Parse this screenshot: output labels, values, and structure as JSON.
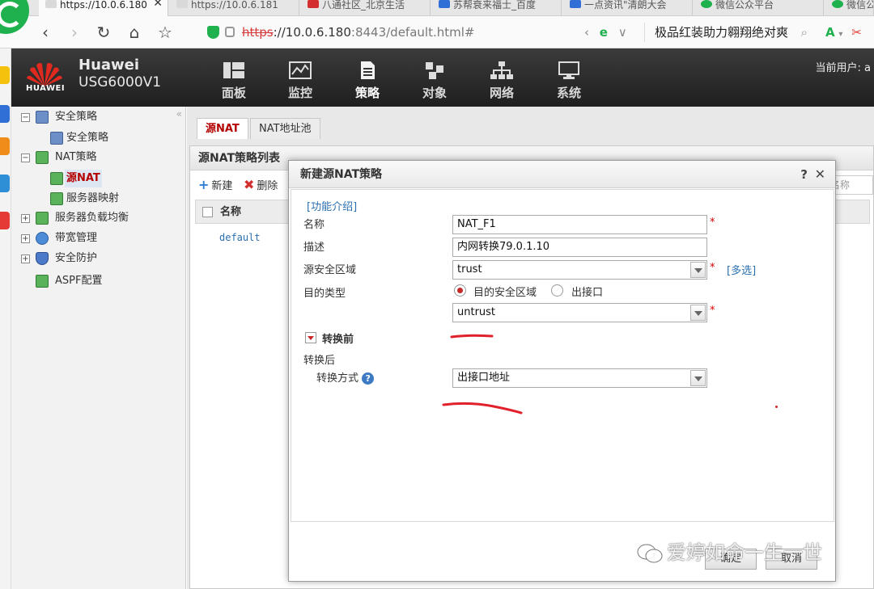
{
  "browser": {
    "tabs": [
      {
        "label": "https://10.0.6.180",
        "active": true
      },
      {
        "label": "https://10.0.6.181"
      },
      {
        "label": "八通社区_北京生活"
      },
      {
        "label": "苏帮衰来福士_百度"
      },
      {
        "label": "一点资讯\"清朗大会"
      },
      {
        "label": "微信公众平台"
      },
      {
        "label": "微信公"
      }
    ],
    "tab_close": "✕",
    "url_scheme": "https",
    "url_host": "://10.0.6.180",
    "url_rest": ":8443/default.html#",
    "search_text": "极品红装助力翱翔绝对爽",
    "accent": "#1fb14e"
  },
  "app": {
    "brand_logo_text": "HUAWEI",
    "brand_name": "Huawei",
    "model": "USG6000V1",
    "menu": [
      {
        "label": "面板",
        "icon": "dashboard-icon"
      },
      {
        "label": "监控",
        "icon": "monitor-icon"
      },
      {
        "label": "策略",
        "icon": "policy-icon"
      },
      {
        "label": "对象",
        "icon": "object-icon"
      },
      {
        "label": "网络",
        "icon": "network-icon"
      },
      {
        "label": "系统",
        "icon": "system-icon"
      }
    ],
    "current_user_label": "当前用户: a"
  },
  "tree": {
    "items": [
      {
        "label": "安全策略"
      },
      {
        "label": "安全策略"
      },
      {
        "label": "NAT策略"
      },
      {
        "label": "源NAT"
      },
      {
        "label": "服务器映射"
      },
      {
        "label": "服务器负载均衡"
      },
      {
        "label": "带宽管理"
      },
      {
        "label": "安全防护"
      },
      {
        "label": "ASPF配置"
      }
    ]
  },
  "content": {
    "tabs": [
      {
        "label": "源NAT"
      },
      {
        "label": "NAT地址池"
      }
    ],
    "panel_title": "源NAT策略列表",
    "toolbar": {
      "new": "新建",
      "delete": "删除"
    },
    "search_placeholder": "名称",
    "grid_column_name": "名称",
    "rows": [
      "default"
    ]
  },
  "dialog": {
    "title": "新建源NAT策略",
    "help": "?",
    "close": "✕",
    "intro_link": "[功能介绍]",
    "name_label": "名称",
    "name_value": "NAT_F1",
    "desc_label": "描述",
    "desc_value": "内网转换79.0.1.10",
    "src_zone_label": "源安全区域",
    "src_zone_value": "trust",
    "multi_select": "[多选]",
    "dest_type_label": "目的类型",
    "dest_opt_zone": "目的安全区域",
    "dest_opt_iface": "出接口",
    "dest_zone_value": "untrust",
    "before_label": "转换前",
    "after_label": "转换后",
    "method_label": "转换方式",
    "method_value": "出接口地址",
    "ok": "确定",
    "cancel": "取消",
    "required_mark": "*"
  },
  "watermark": "爱婷如命一生一世",
  "colors": {
    "header_bg": "#2b2b2b",
    "selected_red": "#b40000",
    "link_blue": "#2a6fb0",
    "ink_red": "#e0202a"
  }
}
